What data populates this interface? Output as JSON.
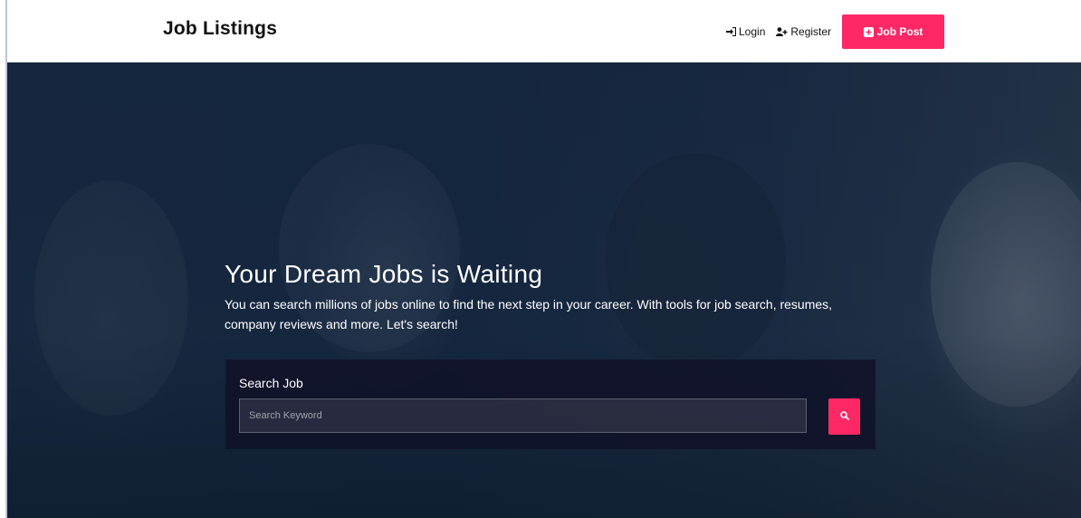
{
  "header": {
    "brand": "Job Listings",
    "nav": {
      "login_label": "Login",
      "register_label": "Register",
      "job_post_label": "Job Post"
    },
    "icons": {
      "login": "sign-in-icon",
      "register": "user-plus-icon",
      "job_post": "plus-square-icon"
    }
  },
  "hero": {
    "title": "Your Dream Jobs is Waiting",
    "description": "You can search millions of jobs online to find the next step in your career. With tools for job search, resumes, company reviews and more. Let's search!",
    "search": {
      "label": "Search Job",
      "placeholder": "Search Keyword",
      "value": "",
      "button_icon": "search-icon"
    }
  },
  "colors": {
    "accent": "#ff2866",
    "hero_overlay": "#0e1e38",
    "search_panel": "#10122a"
  }
}
